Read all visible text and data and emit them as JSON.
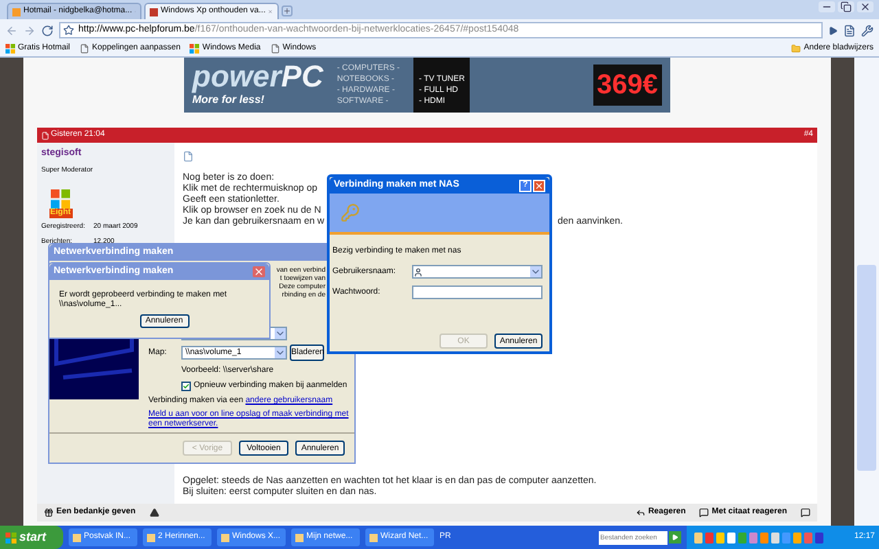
{
  "browser": {
    "tabs": [
      {
        "label": "Hotmail - nidgbelka@hotma...",
        "selected": false
      },
      {
        "label": "Windows Xp onthouden va...",
        "selected": true
      }
    ],
    "url": {
      "host": "http://www.pc-helpforum.be",
      "path": "/f167/onthouden-van-wachtwoorden-bij-netwerklocaties-26457/#post154048"
    },
    "bookmarks": [
      {
        "label": "Gratis Hotmail",
        "kind": "windows"
      },
      {
        "label": "Koppelingen aanpassen",
        "kind": "page"
      },
      {
        "label": "Windows Media",
        "kind": "windows"
      },
      {
        "label": "Windows",
        "kind": "page"
      }
    ],
    "other_bookmarks": "Andere bladwijzers"
  },
  "banner": {
    "brand": "power",
    "brand_suffix": "PC",
    "slogan": "More for less!",
    "categories": [
      "- COMPUTERS -",
      "NOTEBOOKS -",
      "- HARDWARE -",
      "SOFTWARE -"
    ],
    "features": [
      "- TV TUNER",
      "- FULL HD",
      "- HDMI"
    ],
    "price": "369€"
  },
  "post": {
    "date": "Gisteren 21:04",
    "number": "#4",
    "author": {
      "name": "stegisoft",
      "rank": "Super Moderator",
      "avatar_text": "Eight",
      "stats": [
        {
          "label": "Geregistreerd:",
          "value": "20 maart 2009"
        },
        {
          "label": "Berichten:",
          "value": "12.200"
        }
      ]
    },
    "lines": [
      "Nog beter is zo doen:",
      "Klik met de rechtermuisknop op",
      "Geeft een stationletter.",
      "Klik op browser en zoek nu de N",
      "Je kan dan gebruikersnaam en w"
    ],
    "trailing_text": "den aanvinken.",
    "closing_lines": [
      "Opgelet: steeds de Nas aanzetten en wachten tot het klaar is en dan pas de computer aanzetten.",
      "Bij sluiten: eerst computer sluiten en dan nas."
    ],
    "actions": {
      "thanks": "Een bedankje geven",
      "reply": "Reageren",
      "quote": "Met citaat reageren"
    }
  },
  "wizard": {
    "title": "Netwerkverbinding maken",
    "fragments": [
      "van een verbind",
      "t toewijzen van",
      "Deze computer",
      "rbinding en de"
    ],
    "folder_label": "Map:",
    "folder_value": "\\\\nas\\volume_1",
    "browse": "Bladeren",
    "example": "Voorbeeld: \\\\server\\share",
    "reconnect": {
      "label": "Opnieuw verbinding maken bij aanmelden",
      "checked": true
    },
    "other_user_text": "Verbinding maken via een",
    "other_user_link": "andere gebruikersnaam",
    "storage_link": "Meld u aan voor on line opslag of maak verbinding met een netwerkserver.",
    "buttons": [
      {
        "label": "< Vorige",
        "disabled": true
      },
      {
        "label": "Voltooien",
        "disabled": false
      },
      {
        "label": "Annuleren",
        "disabled": false
      }
    ]
  },
  "progress": {
    "title": "Netwerkverbinding maken",
    "message": "Er wordt geprobeerd verbinding te maken met",
    "target": "\\\\nas\\volume_1...",
    "button": "Annuleren"
  },
  "nas_dialog": {
    "title": "Verbinding maken met NAS",
    "help": "?",
    "status": "Bezig verbinding te maken met nas",
    "username_label": "Gebruikersnaam:",
    "password_label": "Wachtwoord:",
    "buttons": [
      {
        "label": "OK",
        "disabled": true
      },
      {
        "label": "Annuleren",
        "disabled": false
      }
    ]
  },
  "taskbar": {
    "start": "start",
    "items": [
      {
        "label": "Postvak IN..."
      },
      {
        "label": "2 Herinnen..."
      },
      {
        "label": "Windows X..."
      },
      {
        "label": "Mijn netwe..."
      },
      {
        "label": "Wizard Net..."
      }
    ],
    "extra": "PR",
    "search_placeholder": "Bestanden zoeken",
    "clock": "12:17"
  }
}
